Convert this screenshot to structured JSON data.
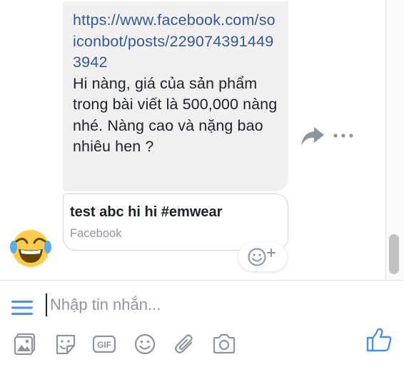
{
  "conversation": {
    "message": {
      "link": "https://www.facebook.com/soiconbot/posts/2290743914493942",
      "text": "Hi nàng, giá của sản phẩm trong bài viết là 500,000 nàng nhé. Nàng cao và nặng bao nhiêu hen ?"
    },
    "link_preview": {
      "title": "test abc hi hi #emwear",
      "source": "Facebook"
    },
    "sender_avatar": "laughing-tears-emoji"
  },
  "composer": {
    "placeholder": "Nhập tin nhắn...",
    "value": "",
    "tools": [
      "image-icon",
      "sticker-icon",
      "gif-icon",
      "emoji-icon",
      "attachment-icon",
      "camera-icon"
    ],
    "send_icon": "thumbs-up-icon"
  },
  "colors": {
    "accent": "#4a90e2",
    "link": "#365899",
    "bubble": "#f1f0f0",
    "icon_gray": "#8d949e"
  }
}
